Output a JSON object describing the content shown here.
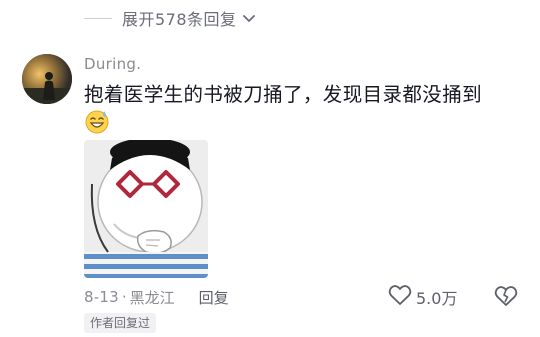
{
  "replies": {
    "expand_label": "展开578条回复",
    "chevron_icon": "chevron-down-icon"
  },
  "comment": {
    "username": "During.",
    "text": "抱着医学生的书被刀捅了，发现目录都没捅到",
    "emoji": "grinning-sweat-emoji",
    "sticker": "thinking-face-sticker",
    "date": "8-13",
    "location": "黑龙江",
    "reply_label": "回复",
    "like_count": "5.0万",
    "author_tag": "作者回复过"
  },
  "colors": {
    "text_primary": "#161823",
    "text_secondary": "#8a8b93",
    "tag_bg": "#f1f1f3"
  }
}
